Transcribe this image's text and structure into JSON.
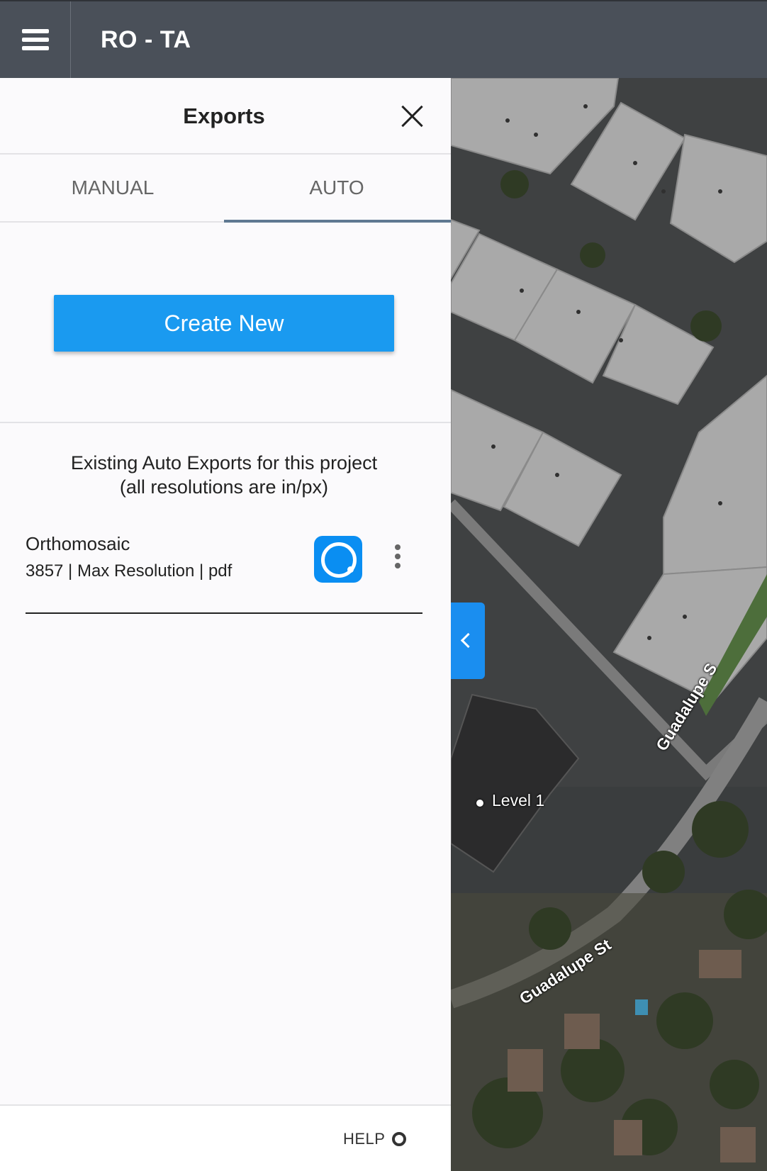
{
  "header": {
    "menu_icon": "hamburger-menu-icon",
    "project_title": "RO - TA"
  },
  "panel": {
    "title": "Exports",
    "close_icon": "close-icon",
    "tabs": [
      {
        "label": "MANUAL",
        "active": false
      },
      {
        "label": "AUTO",
        "active": true
      }
    ],
    "create_button_label": "Create New",
    "existing_heading_line1": "Existing Auto Exports for this project",
    "existing_heading_line2": "(all resolutions are in/px)",
    "exports": [
      {
        "name": "Orthomosaic",
        "meta": "3857 | Max Resolution | pdf",
        "app_icon": "app-integration-icon",
        "menu_icon": "more-vertical-icon"
      }
    ],
    "footer": {
      "help_label": "HELP",
      "help_icon": "lifebuoy-icon"
    }
  },
  "map": {
    "labels": {
      "level": "Level 1",
      "street_1": "Guadalupe S",
      "street_2": "Guadalupe St"
    },
    "collapse_icon": "chevron-left-icon",
    "accent_color": "#1a9af0"
  }
}
